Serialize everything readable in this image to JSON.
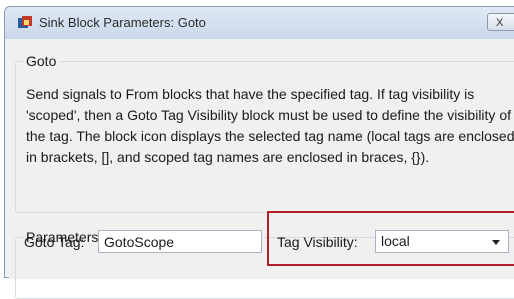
{
  "window": {
    "title": "Sink Block Parameters: Goto",
    "close_label": "X"
  },
  "goto_group": {
    "legend": "Goto",
    "description": "Send signals to From blocks that have the specified tag.  If tag visibility is 'scoped', then a Goto Tag Visibility block must be used to define the visibility of the tag.  The block icon displays the selected tag name (local tags are enclosed in brackets, [], and scoped tag names are enclosed in braces, {})."
  },
  "parameters_group": {
    "legend": "Parameters",
    "goto_tag_label": "Goto Tag:",
    "goto_tag_value": "GotoScope",
    "tag_visibility_label": "Tag Visibility:",
    "tag_visibility_value": "local"
  },
  "colors": {
    "highlight": "#b0202a",
    "window_bg": "#f0f0f0"
  },
  "icons": {
    "app": "simulink-block-icon",
    "dropdown": "chevron-down-icon"
  }
}
